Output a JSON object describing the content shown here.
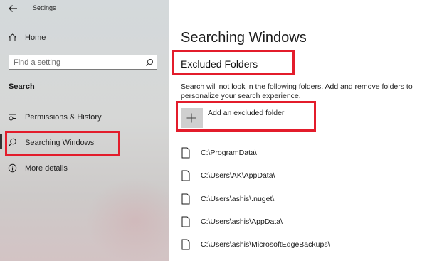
{
  "window": {
    "title": "Settings"
  },
  "sidebar": {
    "home_label": "Home",
    "search_placeholder": "Find a setting",
    "section_heading": "Search",
    "items": [
      {
        "label": "Permissions & History",
        "icon": "permissions-icon"
      },
      {
        "label": "Searching Windows",
        "icon": "search-icon",
        "selected": true
      },
      {
        "label": "More details",
        "icon": "info-icon"
      }
    ]
  },
  "main": {
    "title": "Searching Windows",
    "subtitle": "Excluded Folders",
    "description": "Search will not look in the following folders. Add and remove folders to personalize your search experience.",
    "add_label": "Add an excluded folder",
    "folders": [
      "C:\\ProgramData\\",
      "C:\\Users\\AK\\AppData\\",
      "C:\\Users\\ashis\\.nuget\\",
      "C:\\Users\\ashis\\AppData\\",
      "C:\\Users\\ashis\\MicrosoftEdgeBackups\\"
    ]
  },
  "colors": {
    "highlight": "#e31c2b",
    "accent_tile": "#cfcfcf"
  }
}
